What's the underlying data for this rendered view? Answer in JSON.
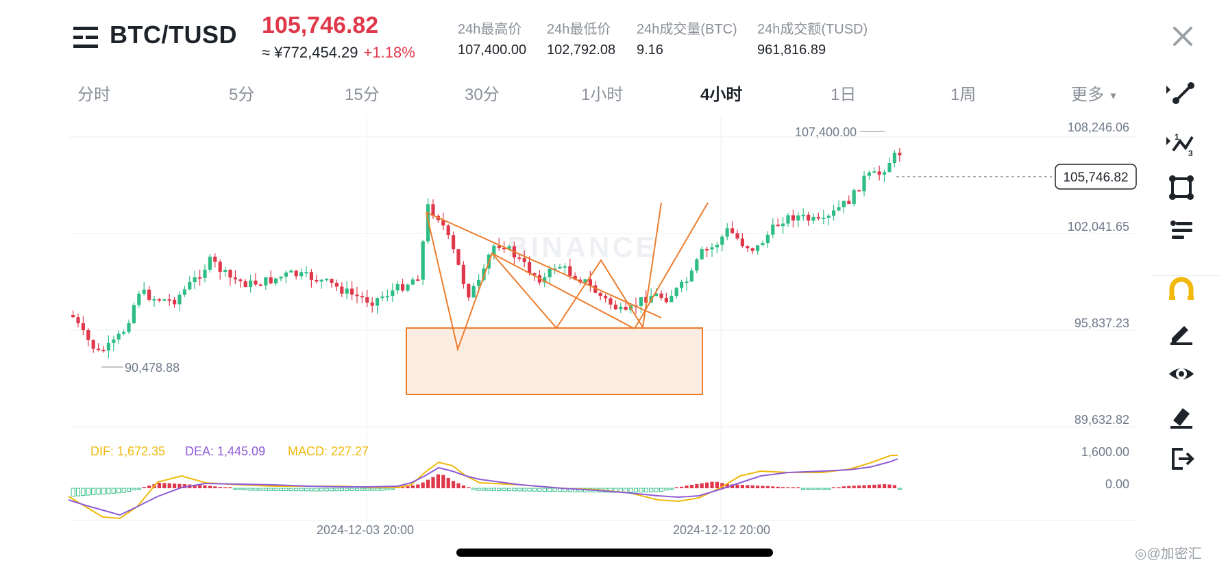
{
  "header": {
    "pair": "BTC/TUSD",
    "price": "105,746.82",
    "cny_price": "≈ ¥772,454.29",
    "change": "+1.18%",
    "stats": [
      {
        "label": "24h最高价",
        "value": "107,400.00"
      },
      {
        "label": "24h最低价",
        "value": "102,792.08"
      },
      {
        "label": "24h成交量(BTC)",
        "value": "9.16"
      },
      {
        "label": "24h成交额(TUSD)",
        "value": "961,816.89"
      }
    ]
  },
  "tabs": [
    "分时",
    "5分",
    "15分",
    "30分",
    "1小时",
    "4小时",
    "1日",
    "1周",
    "更多"
  ],
  "active_tab": "4小时",
  "chart": {
    "watermark": "BINANCE",
    "y_labels": [
      "108,246.06",
      "102,041.65",
      "95,837.23",
      "89,632.82"
    ],
    "current_price_label": "105,746.82",
    "high_label": "107,400.00",
    "low_label": "90,478.88",
    "macd": {
      "dif": "DIF: 1,672.35",
      "dea": "DEA: 1,445.09",
      "macd": "MACD: 227.27",
      "y_labels": [
        "1,600.00",
        "0.00"
      ]
    },
    "x_labels": [
      "2024-12-03 20:00",
      "2024-12-12 20:00"
    ]
  },
  "chart_data": {
    "type": "candlestick",
    "ylim": [
      89632.82,
      108246.06
    ],
    "last": 105746.82,
    "high": 107400.0,
    "low": 90478.88,
    "macd": {
      "dif": 1672.35,
      "dea": 1445.09,
      "macd": 227.27
    },
    "x_ticks": [
      "2024-12-03 20:00",
      "2024-12-12 20:00"
    ],
    "colors": {
      "up": "#2ebd85",
      "down": "#e0384b",
      "dif": "#f0b90b",
      "dea": "#8e5cd6",
      "drawing": "#ec7c2c"
    }
  },
  "toolbar": [
    "line-tool-icon",
    "fib-tool-icon",
    "shape-tool-icon",
    "text-tool-icon",
    "magnet-icon",
    "brush-icon",
    "visibility-icon",
    "eraser-icon",
    "exit-icon"
  ],
  "footer": {
    "watermark": "◎@加密汇"
  }
}
